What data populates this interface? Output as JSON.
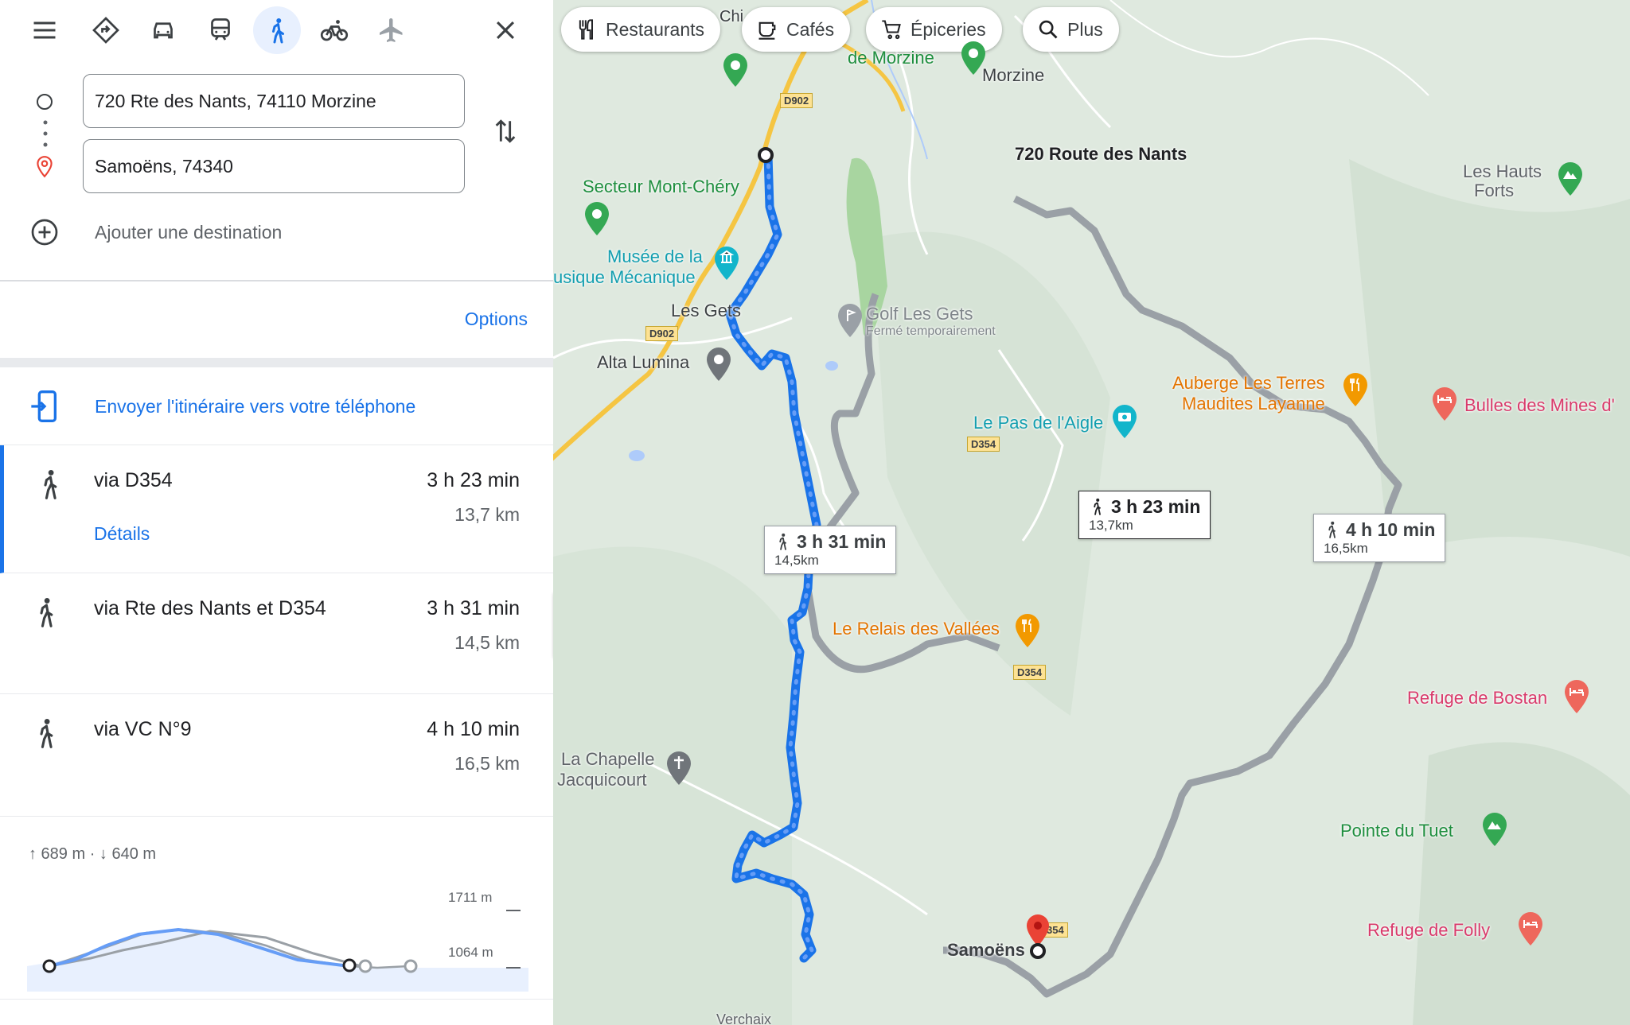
{
  "travel_modes": [
    {
      "name": "best",
      "icon": "directions-icon"
    },
    {
      "name": "car",
      "icon": "car-icon"
    },
    {
      "name": "transit",
      "icon": "train-icon"
    },
    {
      "name": "walking",
      "icon": "walk-icon",
      "active": true
    },
    {
      "name": "bicycle",
      "icon": "bike-icon"
    },
    {
      "name": "flight",
      "icon": "plane-icon"
    }
  ],
  "origin": {
    "value": "720 Rte des Nants, 74110 Morzine"
  },
  "destination": {
    "value": "Samoëns, 74340"
  },
  "add_destination": "Ajouter une destination",
  "options": "Options",
  "send_to_phone": "Envoyer l'itinéraire vers votre téléphone",
  "routes": [
    {
      "name": "via D354",
      "time": "3 h 23 min",
      "distance": "13,7 km",
      "details": "Détails",
      "selected": true
    },
    {
      "name": "via Rte des Nants et D354",
      "time": "3 h 31 min",
      "distance": "14,5 km"
    },
    {
      "name": "via VC N°9",
      "time": "4 h 10 min",
      "distance": "16,5 km"
    }
  ],
  "elevation": {
    "summary": "↑ 689 m · ↓ 640 m",
    "max": "1711 m",
    "min": "1064 m"
  },
  "chips": [
    {
      "label": "Restaurants",
      "icon": "fork-knife-icon"
    },
    {
      "label": "Cafés",
      "icon": "coffee-icon"
    },
    {
      "label": "Épiceries",
      "icon": "cart-icon"
    },
    {
      "label": "Plus",
      "icon": "search-icon"
    }
  ],
  "map": {
    "places": {
      "morzine": "Morzine",
      "de_morzine": "de Morzine",
      "chi": "Chi",
      "secteur": "Secteur Mont-Chéry",
      "musee1": "Musée de la",
      "musee2": "usique Mécanique",
      "les_gets": "Les Gets",
      "golf1": "Golf Les Gets",
      "golf2": "Fermé temporairement",
      "alta": "Alta Lumina",
      "pas": "Le Pas de l'Aigle",
      "auberge1": "Auberge Les Terres",
      "auberge2": "Maudites Layanne",
      "bulles": "Bulles des Mines d'",
      "hauts1": "Les Hauts",
      "hauts2": "Forts",
      "relais": "Le Relais des Vallées",
      "refuge_bostan": "Refuge de Bostan",
      "pointe": "Pointe du Tuet",
      "refuge_folly": "Refuge de Folly",
      "chapelle1": "La Chapelle",
      "chapelle2": "Jacquicourt",
      "samoens": "Samoëns",
      "verchaix": "Verchaix",
      "start_label": "720 Route des Nants"
    },
    "shields": {
      "d902a": "D902",
      "d902b": "D902",
      "d354a": "D354",
      "d354b": "D354",
      "d354c": "354"
    },
    "route_labels": [
      {
        "time": "3 h 23 min",
        "distance": "13,7km"
      },
      {
        "time": "3 h 31 min",
        "distance": "14,5km"
      },
      {
        "time": "4 h 10 min",
        "distance": "16,5km"
      }
    ]
  },
  "colors": {
    "accent": "#1a73e8",
    "route_selected": "#1a73e8",
    "route_alt": "#9aa0a6",
    "map_bg": "#dfe9df"
  }
}
